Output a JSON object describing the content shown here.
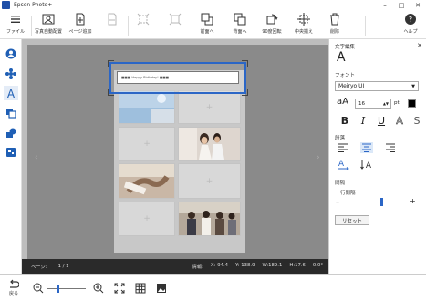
{
  "window": {
    "title": "Epson Photo+"
  },
  "toolbar": {
    "file": "ファイル",
    "auto_layout": "写真自動配置",
    "add_page": "ページ追加",
    "delete_page": "削除",
    "t5": "",
    "t6": "",
    "t7": "",
    "bring_front": "前面へ",
    "send_back": "背面へ",
    "rotate90": "90度回転",
    "center_align": "中央揃え",
    "remove": "削除",
    "help": "ヘルプ"
  },
  "left_sidebar": {
    "items": [
      "person-icon",
      "stamp-icon",
      "text-icon",
      "layers-icon",
      "shapes-icon",
      "palette-icon"
    ]
  },
  "canvas": {
    "text_frame_content": "■■■ Happy Birthday! ■■■"
  },
  "status": {
    "page_label": "ページ:",
    "page_value": "1  /  1",
    "info_label": "情報:",
    "x": "X:-94.4",
    "y": "Y:-138.9",
    "w": "W:189.1",
    "h": "H:17.6",
    "angle": "0.0°"
  },
  "bottombar": {
    "back_label": "戻る",
    "zoom_level": 0.25
  },
  "text_panel": {
    "title": "文字編集",
    "font_label": "フォント",
    "font_value": "Meiryo UI",
    "size_value": "16",
    "size_unit": "pt",
    "text_color": "#000000",
    "paragraph_label": "段落",
    "spacing_label": "間隔",
    "line_spacing_label": "行間隔",
    "line_spacing_level": 0.62,
    "reset_label": "リセット"
  },
  "colors": {
    "accent": "#2b66c6",
    "canvas_bg": "#8a8a8a",
    "status_bg": "#2a2a2a"
  }
}
